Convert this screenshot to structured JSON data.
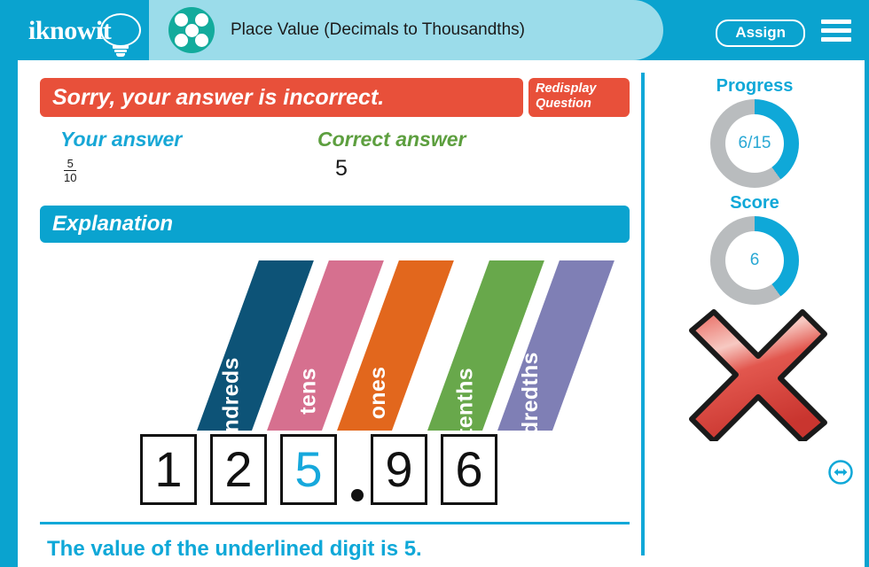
{
  "header": {
    "logo_text": "iknowit",
    "logo_icon": "lightbulb-icon",
    "topic_icon": "five-dot-circle-icon",
    "title": "Place Value (Decimals to Thousandths)",
    "assign_label": "Assign",
    "menu_icon": "hamburger-menu-icon",
    "colors": {
      "bar": "#0aa3cf",
      "pill": "#9bdcea",
      "topic_icon": "#13ab9c"
    }
  },
  "feedback": {
    "message": "Sorry, your answer is incorrect.",
    "redisplay_label": "Redisplay Question",
    "color": "#e8503a"
  },
  "answers": {
    "your_label": "Your answer",
    "your_value_numerator": "5",
    "your_value_denominator": "10",
    "correct_label": "Correct answer",
    "correct_value": "5",
    "your_color": "#17a7d6",
    "correct_color": "#5d9f3f"
  },
  "explanation": {
    "heading": "Explanation",
    "heading_color": "#0aa3cf",
    "conclusion": "The value of the underlined digit is 5.",
    "conclusion_color": "#0fa8d8",
    "place_value": {
      "banners": [
        {
          "label": "hundreds",
          "color": "#0d5377"
        },
        {
          "label": "tens",
          "color": "#d6708f"
        },
        {
          "label": "ones",
          "color": "#e2671d"
        },
        {
          "label": "tenths",
          "color": "#68a84b"
        },
        {
          "label": "hundredths",
          "color": "#7f7fb5"
        }
      ],
      "digits": [
        "1",
        "2",
        "5",
        "9",
        "6"
      ],
      "highlighted_index": 2,
      "highlight_color": "#16a8dc",
      "decimal_point_after_index": 2,
      "number": "125.96"
    }
  },
  "sidebar": {
    "progress_label": "Progress",
    "progress_value": "6/15",
    "progress_percent": 40,
    "score_label": "Score",
    "score_value": "6",
    "score_percent": 40,
    "result_icon": "red-x-mark-icon",
    "next_icon": "next-arrow-icon",
    "accent_color": "#0fa8d8",
    "track_color": "#b9bcbe"
  }
}
